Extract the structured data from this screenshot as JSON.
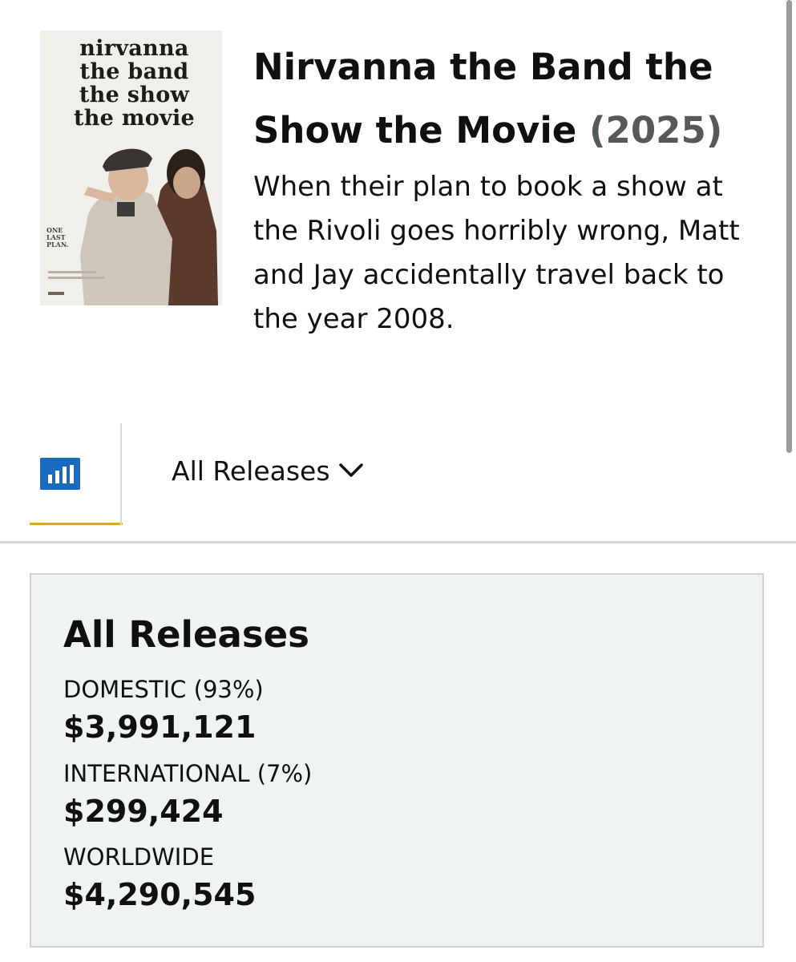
{
  "movie": {
    "title": "Nirvanna the Band the Show the Movie",
    "year": "(2025)",
    "synopsis": "When their plan to book a show at the Rivoli goes horribly wrong, Matt and Jay accidentally travel back to the year 2008."
  },
  "poster": {
    "title_text": "nirvanna\nthe band\nthe show\nthe movie",
    "tagline": "ONE\nLAST\nPLAN."
  },
  "tabs": {
    "chart_icon": "bar-chart-icon",
    "release_selector_label": "All Releases",
    "chevron_icon": "chevron-down-icon"
  },
  "summary": {
    "heading": "All Releases",
    "domestic_label": "DOMESTIC (93%)",
    "domestic_value": "$3,991,121",
    "international_label": "INTERNATIONAL (7%)",
    "international_value": "$299,424",
    "worldwide_label": "WORLDWIDE",
    "worldwide_value": "$4,290,545"
  },
  "colors": {
    "accent_tab": "#e3a330",
    "icon_blue": "#1b6ac1",
    "card_bg": "#f0f3f3",
    "year_gray": "#565959"
  }
}
